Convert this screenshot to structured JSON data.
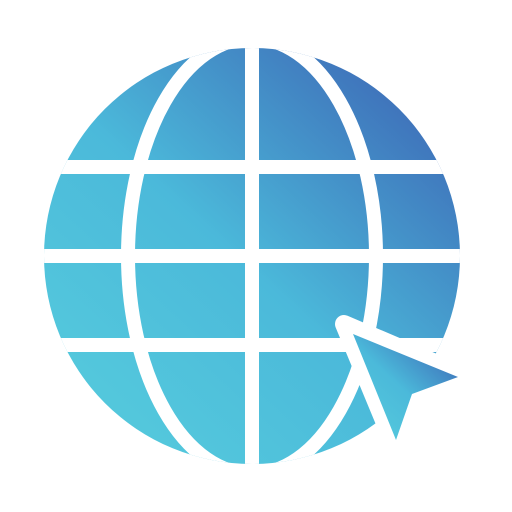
{
  "icon": {
    "name": "globe-cursor-icon",
    "colors": {
      "gradient_light": "#53c7dc",
      "gradient_dark": "#3f73bb",
      "grid_lines": "#ffffff",
      "background": "#ffffff"
    }
  }
}
